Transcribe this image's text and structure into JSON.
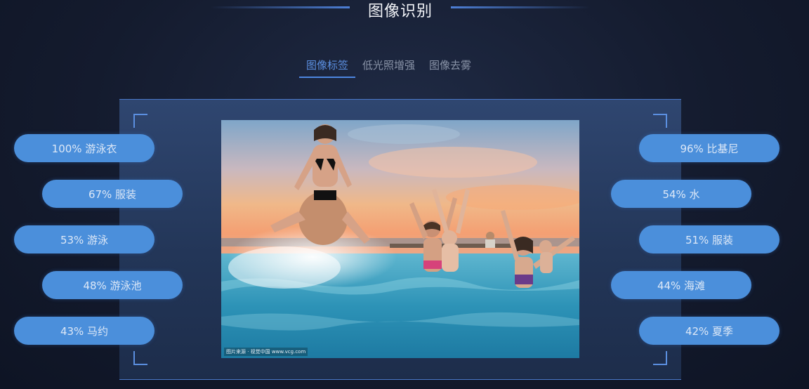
{
  "section_title": "图像识别",
  "tabs": [
    {
      "label": "图像标签",
      "active": true
    },
    {
      "label": "低光照增强",
      "active": false
    },
    {
      "label": "图像去雾",
      "active": false
    }
  ],
  "photo_credit": "图片来源 · 视觉中国 www.vcg.com",
  "left_tags": [
    {
      "text": "100% 游泳衣"
    },
    {
      "text": "67% 服装"
    },
    {
      "text": "53% 游泳"
    },
    {
      "text": "48% 游泳池"
    },
    {
      "text": "43% 马约"
    }
  ],
  "right_tags": [
    {
      "text": "96% 比基尼"
    },
    {
      "text": "54% 水"
    },
    {
      "text": "51% 服装"
    },
    {
      "text": "44% 海滩"
    },
    {
      "text": "42% 夏季"
    }
  ],
  "colors": {
    "accent": "#4d86e0",
    "tag_bg": "#4b8fdb",
    "panel_bg": "#2f4670",
    "page_bg": "#141b2e"
  }
}
